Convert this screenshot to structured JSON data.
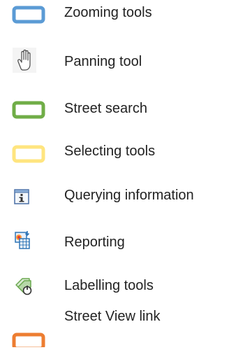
{
  "legend": {
    "items": [
      {
        "label": "Zooming tools",
        "icon": "blue-rectangle-icon",
        "color": "#5b9bd5"
      },
      {
        "label": "Panning tool",
        "icon": "hand-icon",
        "color": "#808080"
      },
      {
        "label": "Street search",
        "icon": "green-rectangle-icon",
        "color": "#70ad47"
      },
      {
        "label": "Selecting tools",
        "icon": "yellow-rectangle-icon",
        "color": "#ffe57f"
      },
      {
        "label": "Querying information",
        "icon": "info-icon",
        "color": "#4a6fa5"
      },
      {
        "label": "Reporting",
        "icon": "report-icon",
        "color": "#2e75b6"
      },
      {
        "label": "Labelling tools",
        "icon": "label-tag-icon",
        "color": "#6aa84f"
      },
      {
        "label": "Street View link",
        "icon": "orange-rectangle-icon",
        "color": "#ed7d31"
      }
    ]
  }
}
